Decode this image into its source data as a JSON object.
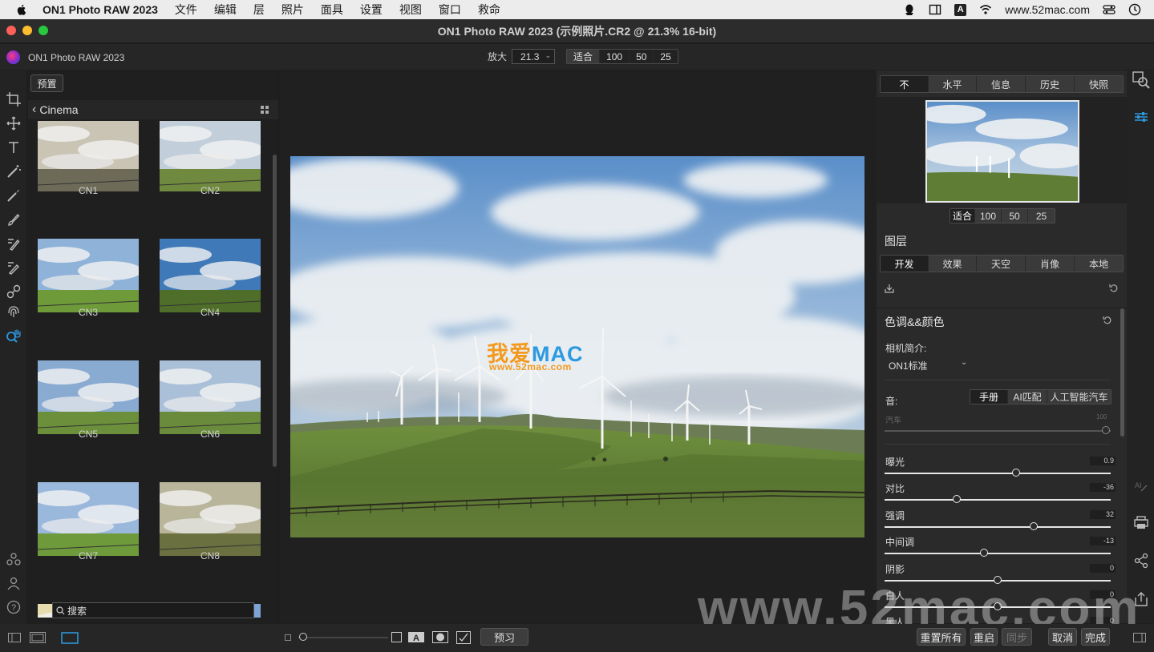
{
  "menubar": {
    "app": "ON1 Photo RAW 2023",
    "items": [
      "文件",
      "编辑",
      "层",
      "照片",
      "面具",
      "设置",
      "视图",
      "窗口",
      "救命"
    ],
    "website": "www.52mac.com"
  },
  "window": {
    "title": "ON1 Photo RAW 2023 (示例照片.CR2 @ 21.3% 16-bit)"
  },
  "toolbar": {
    "brand": "ON1 Photo RAW 2023",
    "zoom_label": "放大",
    "zoom_value": "21.3",
    "zoom_presets": [
      "适合",
      "100",
      "50",
      "25"
    ]
  },
  "left_panel": {
    "preset_button": "预置",
    "category": "Cinema",
    "thumbnails": [
      "CN1",
      "CN2",
      "CN3",
      "CN4",
      "CN5",
      "CN6",
      "CN7",
      "CN8"
    ],
    "search_placeholder": "搜索"
  },
  "canvas": {
    "watermark_logo_a": "我爱",
    "watermark_logo_b": "MAC",
    "watermark_url": "www.52mac.com",
    "big_watermark": "www.52mac.com"
  },
  "right_panel": {
    "view_tabs": [
      "不",
      "水平",
      "信息",
      "历史",
      "快照"
    ],
    "nav_zoom": [
      "适合",
      "100",
      "50",
      "25"
    ],
    "layers_title": "图层",
    "module_tabs": [
      "开发",
      "效果",
      "天空",
      "肖像",
      "本地"
    ],
    "section_title": "色调&&颜色",
    "camera_profile_label": "相机简介:",
    "camera_profile_value": "ON1标准",
    "tone_label": "音:",
    "tone_modes": [
      "手册",
      "AI匹配",
      "人工智能汽车"
    ],
    "auto_label": "汽车",
    "auto_value": "100",
    "sliders": [
      {
        "label": "曝光",
        "value": "0.9",
        "position": 0.58
      },
      {
        "label": "对比",
        "value": "-36",
        "position": 0.32
      },
      {
        "label": "强调",
        "value": "32",
        "position": 0.66
      },
      {
        "label": "中间调",
        "value": "-13",
        "position": 0.44
      },
      {
        "label": "阴影",
        "value": "0",
        "position": 0.5
      },
      {
        "label": "白人",
        "value": "0",
        "position": 0.5
      },
      {
        "label": "黑人",
        "value": "0",
        "position": 0.5
      }
    ]
  },
  "bottombar": {
    "preview": "预习",
    "reset_all": "重置所有",
    "reset": "重启",
    "sync": "同步",
    "cancel": "取消",
    "done": "完成"
  },
  "colors": {
    "accent": "#2d9ae0",
    "watermark_orange": "#f39a1e"
  }
}
